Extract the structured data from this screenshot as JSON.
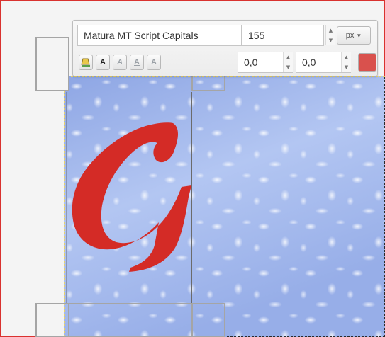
{
  "toolbar": {
    "font_name": "Matura MT Script Capitals",
    "font_size": "155",
    "unit": "px",
    "x_offset": "0,0",
    "y_offset": "0,0",
    "text_color": "#d9514d",
    "style_buttons": [
      {
        "icon": "paint-bucket-icon",
        "glyph": ""
      },
      {
        "icon": "bold-a-icon",
        "glyph": "A"
      },
      {
        "icon": "italic-a-icon",
        "glyph": "A"
      },
      {
        "icon": "underline-a-icon",
        "glyph": "A"
      },
      {
        "icon": "strike-a-icon",
        "glyph": "A"
      }
    ]
  },
  "canvas": {
    "text_layer": "G",
    "text_color": "#d42b26"
  }
}
